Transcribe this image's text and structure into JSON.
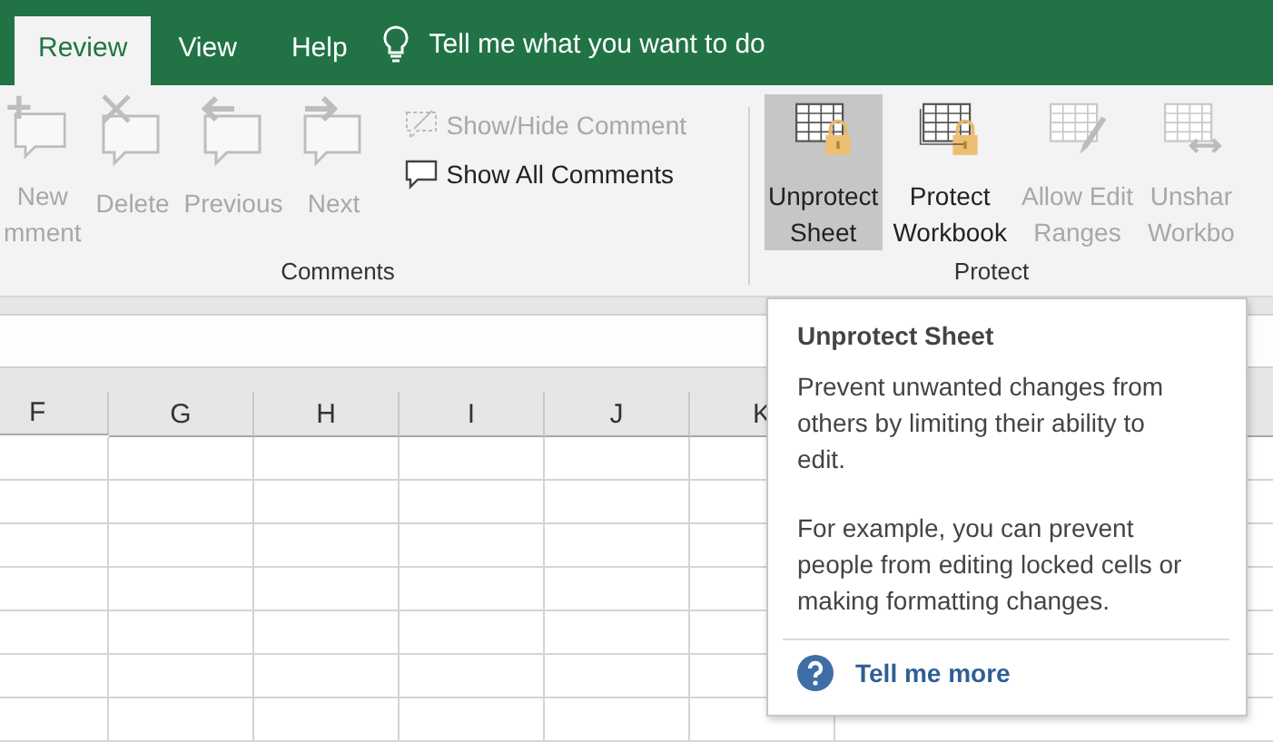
{
  "tabs": [
    {
      "label": "Review",
      "selected": true
    },
    {
      "label": "View",
      "selected": false
    },
    {
      "label": "Help",
      "selected": false
    }
  ],
  "tell_me": {
    "placeholder": "Tell me what you want to do"
  },
  "ribbon": {
    "groups": [
      {
        "label": "Comments",
        "large_buttons": [
          {
            "lines": [
              "New",
              "mment"
            ],
            "disabled": true,
            "highlighted": false
          },
          {
            "lines": [
              "Delete"
            ],
            "disabled": true,
            "highlighted": false
          },
          {
            "lines": [
              "Previous"
            ],
            "disabled": true,
            "highlighted": false
          },
          {
            "lines": [
              "Next"
            ],
            "disabled": true,
            "highlighted": false
          }
        ],
        "small_buttons": [
          {
            "label": "Show/Hide Comment",
            "disabled": true
          },
          {
            "label": "Show All Comments",
            "disabled": false
          }
        ]
      },
      {
        "label": "Protect",
        "large_buttons": [
          {
            "lines": [
              "Unprotect",
              "Sheet"
            ],
            "disabled": false,
            "highlighted": true
          },
          {
            "lines": [
              "Protect",
              "Workbook"
            ],
            "disabled": false,
            "highlighted": false
          },
          {
            "lines": [
              "Allow Edit",
              "Ranges"
            ],
            "disabled": true,
            "highlighted": false
          },
          {
            "lines": [
              "Unshar",
              "Workbo"
            ],
            "disabled": true,
            "highlighted": false
          }
        ]
      }
    ]
  },
  "sheet": {
    "columns": [
      "F",
      "G",
      "H",
      "I",
      "J",
      "K"
    ]
  },
  "tooltip": {
    "title": "Unprotect Sheet",
    "paragraphs": [
      "Prevent unwanted changes from others by limiting their ability to edit.",
      "For example, you can prevent people from editing locked cells or making formatting changes."
    ],
    "link": "Tell me more"
  }
}
